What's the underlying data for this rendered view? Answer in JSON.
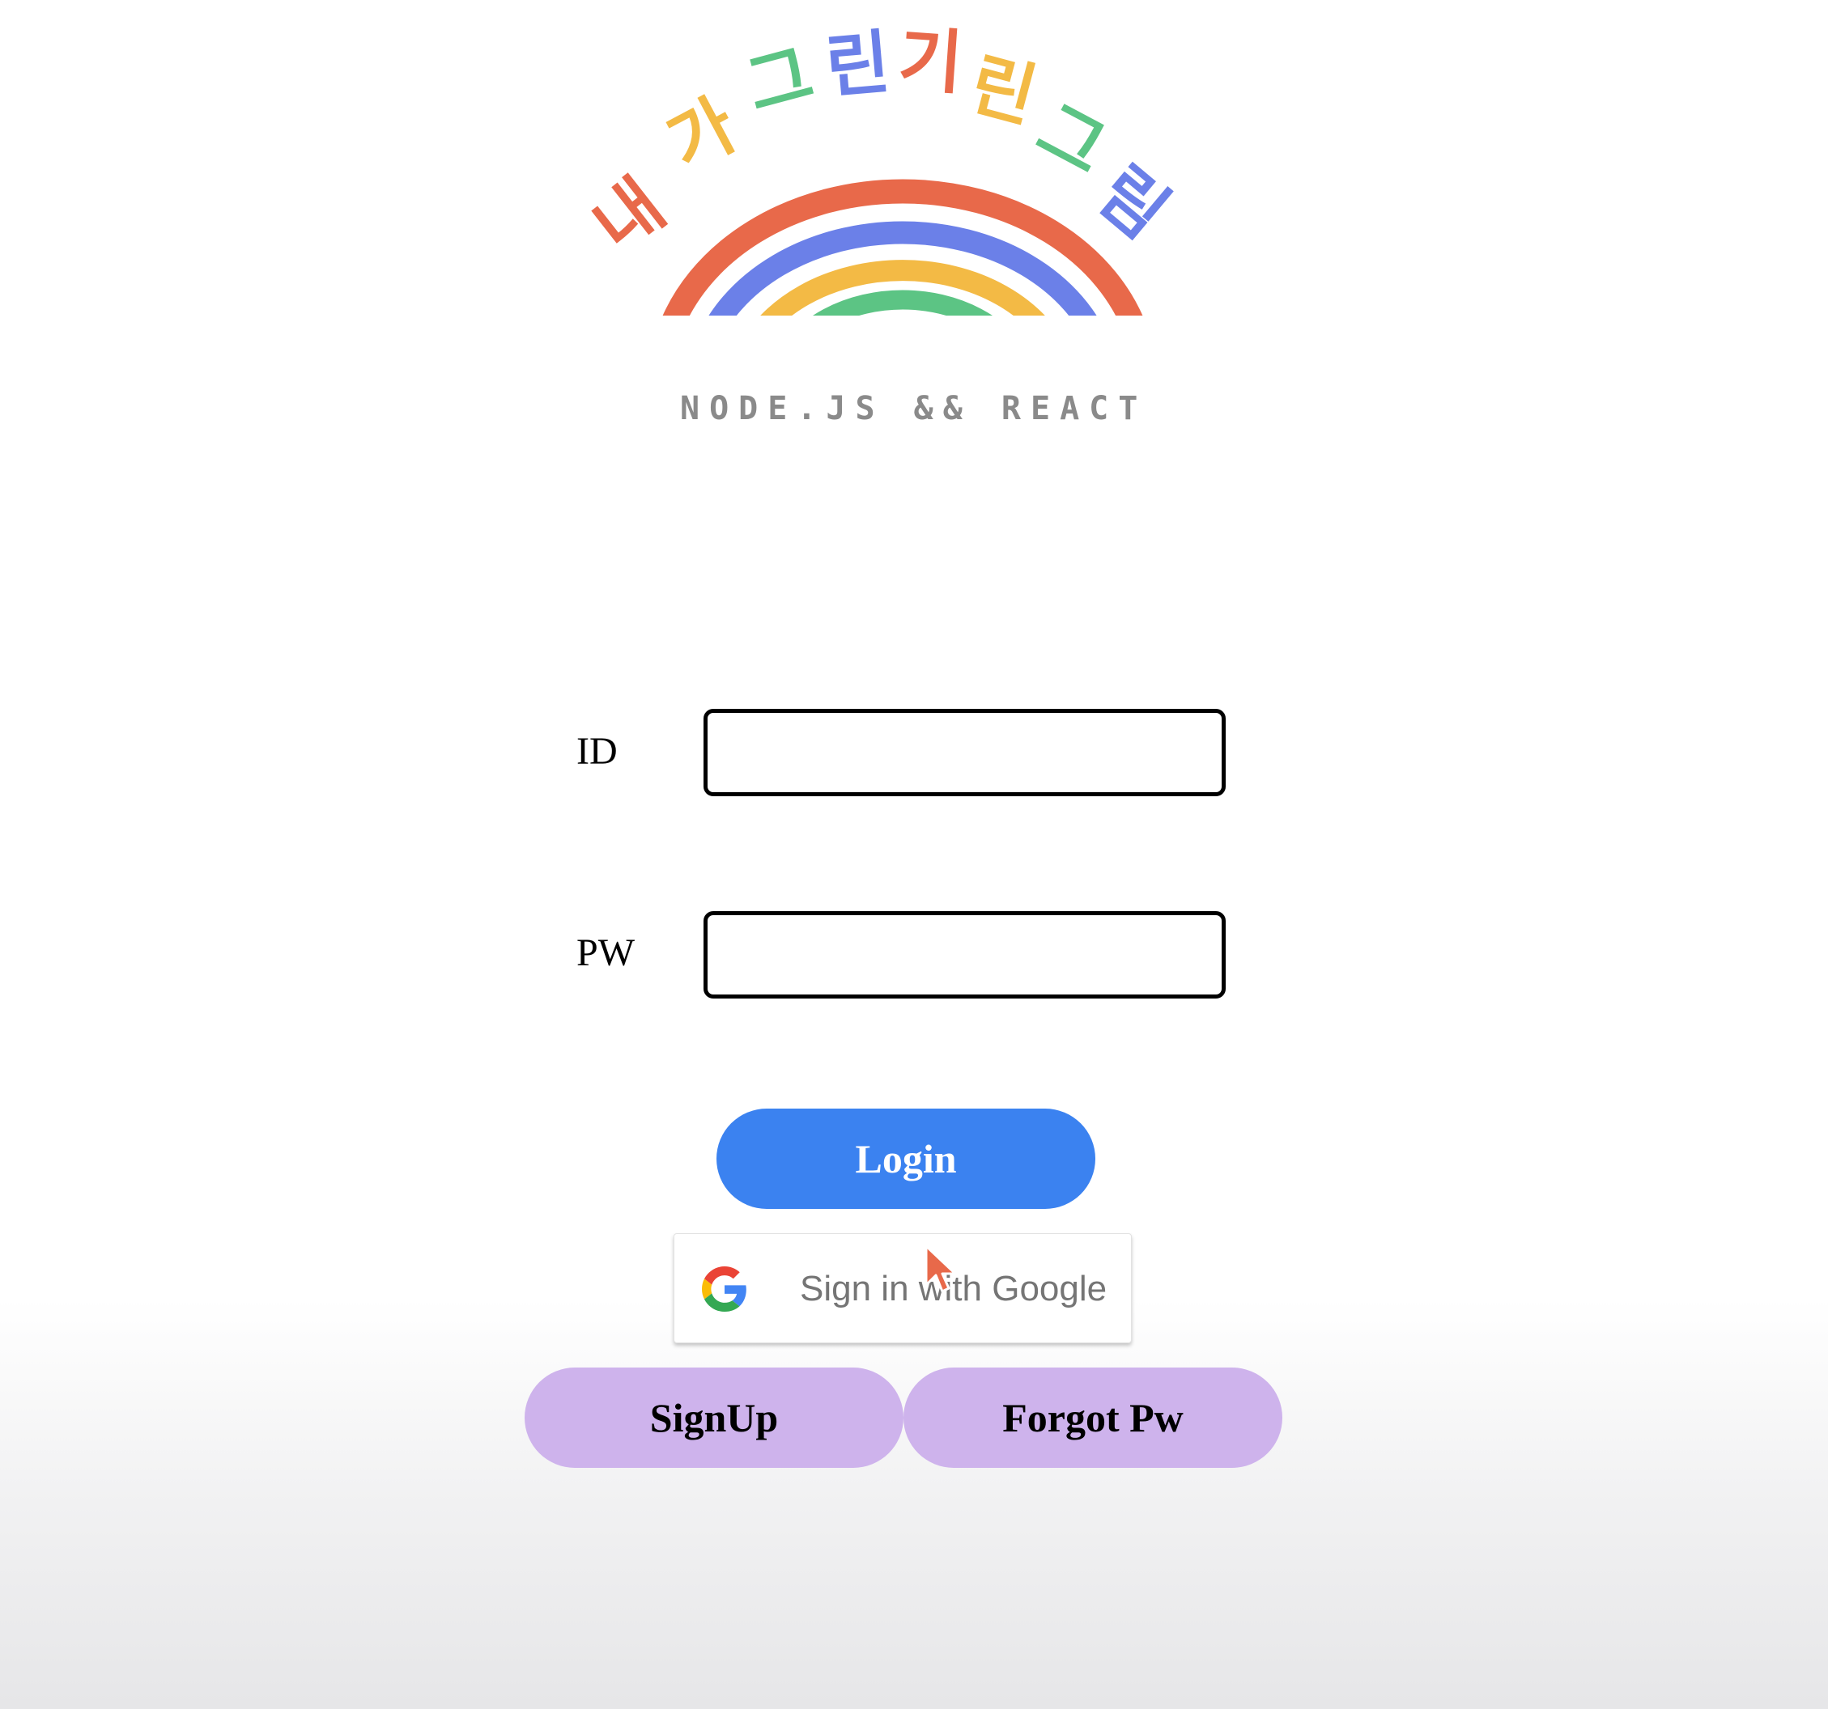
{
  "logo": {
    "title_chars": [
      "내",
      "가",
      "그",
      "린",
      "기",
      "린",
      "그",
      "림"
    ],
    "subtitle": "NODE.JS && REACT",
    "colors": {
      "red": "#e8694a",
      "blue": "#6b80e8",
      "yellow": "#f3ba45",
      "green": "#5cc484",
      "subtitle": "#8a8a8a"
    }
  },
  "form": {
    "id_label": "ID",
    "id_value": "",
    "pw_label": "PW",
    "pw_value": ""
  },
  "buttons": {
    "login": "Login",
    "google": "Sign in with Google",
    "signup": "SignUp",
    "forgot": "Forgot Pw"
  },
  "colors": {
    "login_bg": "#3b82f0",
    "secondary_bg": "#ceb3ec",
    "google_text": "#757575"
  },
  "icons": {
    "google": "google-g-icon",
    "cursor": "mouse-pointer-icon"
  }
}
